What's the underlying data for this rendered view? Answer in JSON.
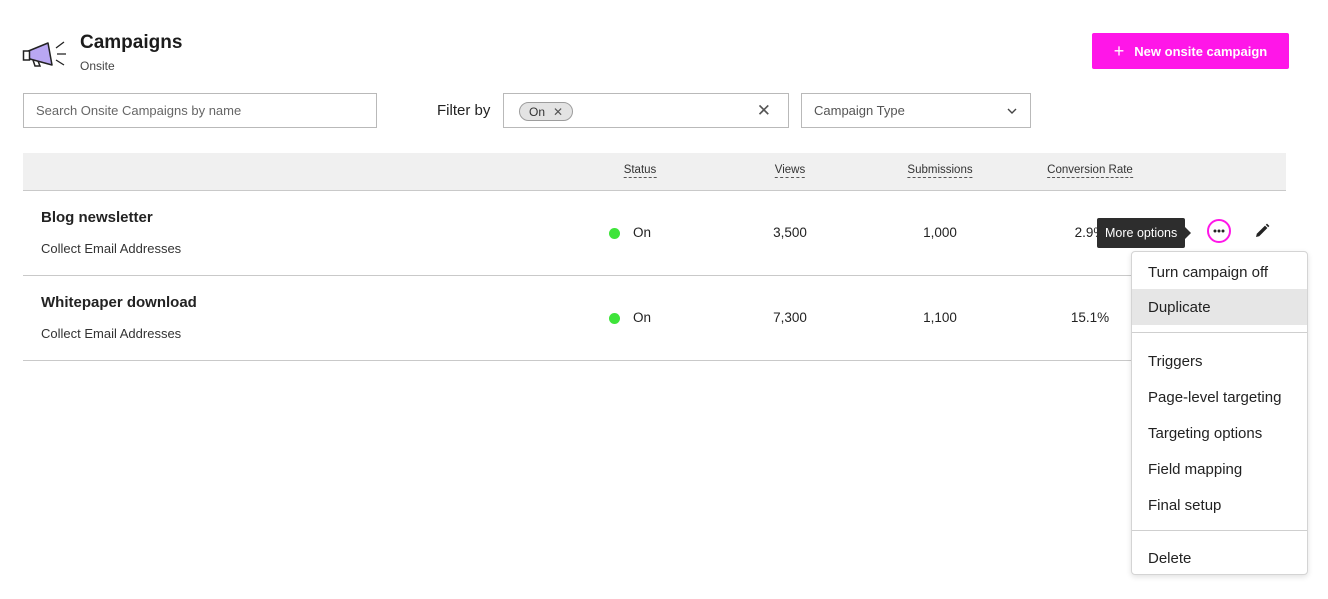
{
  "header": {
    "title": "Campaigns",
    "subtitle": "Onsite",
    "icon": "megaphone-icon",
    "new_button_label": "New onsite campaign"
  },
  "filters": {
    "search_placeholder": "Search Onsite Campaigns by name",
    "filter_by_label": "Filter by",
    "active_chip": "On",
    "campaign_type_placeholder": "Campaign Type"
  },
  "table": {
    "columns": [
      "Status",
      "Views",
      "Submissions",
      "Conversion Rate"
    ],
    "rows": [
      {
        "name": "Blog newsletter",
        "type": "Collect Email Addresses",
        "status": "On",
        "views": "3,500",
        "submissions": "1,000",
        "conversion_rate": "2.9%"
      },
      {
        "name": "Whitepaper download",
        "type": "Collect Email Addresses",
        "status": "On",
        "views": "7,300",
        "submissions": "1,100",
        "conversion_rate": "15.1%"
      }
    ]
  },
  "tooltip": "More options",
  "menu": {
    "items": [
      "Turn campaign off",
      "Duplicate",
      "Triggers",
      "Page-level targeting",
      "Targeting options",
      "Field mapping",
      "Final setup",
      "Delete"
    ],
    "hovered": "Duplicate"
  },
  "colors": {
    "accent": "#ff16e8",
    "status_on": "#3ee43a",
    "header_bg": "#f0f0f0"
  }
}
